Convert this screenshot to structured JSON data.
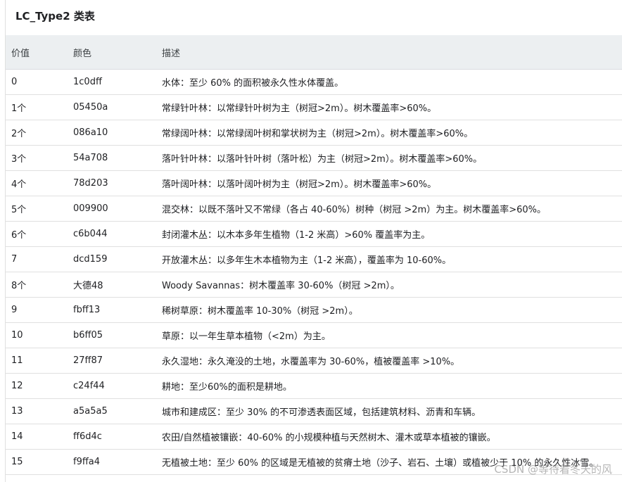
{
  "title": "LC_Type2 类表",
  "columns": [
    "价值",
    "颜色",
    "描述"
  ],
  "rows": [
    {
      "value": "0",
      "color": "1c0dff",
      "desc": "水体：至少 60% 的面积被永久性水体覆盖。"
    },
    {
      "value": "1个",
      "color": "05450a",
      "desc": "常绿针叶林：以常绿针叶树为主（树冠>2m）。树木覆盖率>60%。"
    },
    {
      "value": "2个",
      "color": "086a10",
      "desc": "常绿阔叶林：以常绿阔叶树和掌状树为主（树冠>2m）。树木覆盖率>60%。"
    },
    {
      "value": "3个",
      "color": "54a708",
      "desc": "落叶针叶林：以落叶针叶树（落叶松）为主（树冠>2m）。树木覆盖率>60%。"
    },
    {
      "value": "4个",
      "color": "78d203",
      "desc": "落叶阔叶林：以落叶阔叶树为主（树冠>2m）。树木覆盖率>60%。"
    },
    {
      "value": "5个",
      "color": "009900",
      "desc": "混交林：以既不落叶又不常绿（各占 40-60%）树种（树冠 >2m）为主。树木覆盖率>60%。"
    },
    {
      "value": "6个",
      "color": "c6b044",
      "desc": "封闭灌木丛：以木本多年生植物（1-2 米高）>60% 覆盖率为主。"
    },
    {
      "value": "7",
      "color": "dcd159",
      "desc": "开放灌木丛：以多年生木本植物为主（1-2 米高），覆盖率为 10-60%。"
    },
    {
      "value": "8个",
      "color": "大德48",
      "desc": "Woody Savannas：树木覆盖率 30-60%（树冠 >2m）。"
    },
    {
      "value": "9",
      "color": "fbff13",
      "desc": "稀树草原：树木覆盖率 10-30%（树冠 >2m）。"
    },
    {
      "value": "10",
      "color": "b6ff05",
      "desc": "草原：以一年生草本植物（<2m）为主。"
    },
    {
      "value": "11",
      "color": "27ff87",
      "desc": "永久湿地：永久淹没的土地，水覆盖率为 30-60%，植被覆盖率 >10%。"
    },
    {
      "value": "12",
      "color": "c24f44",
      "desc": "耕地：至少60%的面积是耕地。"
    },
    {
      "value": "13",
      "color": "a5a5a5",
      "desc": "城市和建成区：至少 30% 的不可渗透表面区域，包括建筑材料、沥青和车辆。"
    },
    {
      "value": "14",
      "color": "ff6d4c",
      "desc": "农田/自然植被镶嵌：40-60% 的小规模种植与天然树木、灌木或草本植被的镶嵌。"
    },
    {
      "value": "15",
      "color": "f9ffa4",
      "desc": "无植被土地：至少 60% 的区域是无植被的贫瘠土地（沙子、岩石、土壤）或植被少于 10% 的永久性冰雪。"
    }
  ],
  "watermark": "CSDN @等待着冬天的风"
}
